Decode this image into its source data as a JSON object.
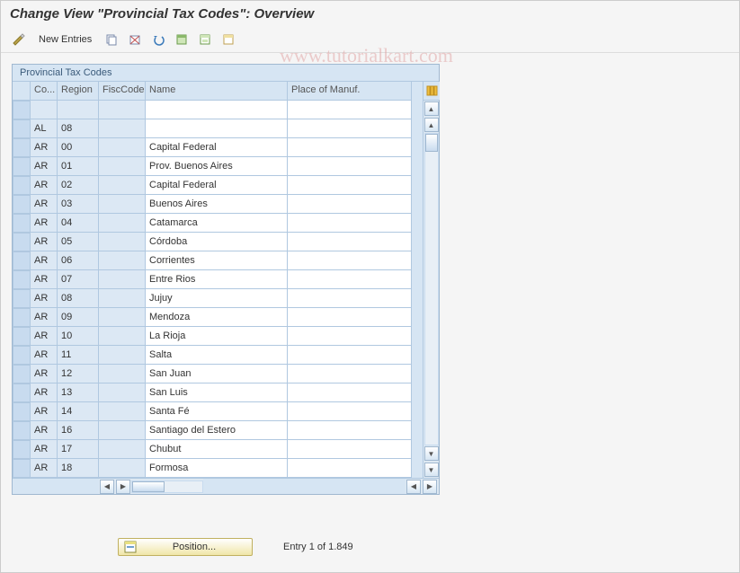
{
  "header": {
    "title": "Change View \"Provincial Tax Codes\": Overview"
  },
  "toolbar": {
    "new_entries": "New Entries"
  },
  "watermark": "www.tutorialkart.com",
  "grid": {
    "title": "Provincial Tax Codes",
    "columns": {
      "co": "Co...",
      "region": "Region",
      "fisc": "FiscCode",
      "name": "Name",
      "pom": "Place of Manuf."
    },
    "rows": [
      {
        "co": "",
        "region": "",
        "fisc": "",
        "name": "",
        "pom": ""
      },
      {
        "co": "AL",
        "region": "08",
        "fisc": "",
        "name": "",
        "pom": ""
      },
      {
        "co": "AR",
        "region": "00",
        "fisc": "",
        "name": "Capital Federal",
        "pom": ""
      },
      {
        "co": "AR",
        "region": "01",
        "fisc": "",
        "name": "Prov. Buenos Aires",
        "pom": ""
      },
      {
        "co": "AR",
        "region": "02",
        "fisc": "",
        "name": "Capital Federal",
        "pom": ""
      },
      {
        "co": "AR",
        "region": "03",
        "fisc": "",
        "name": "Buenos Aires",
        "pom": ""
      },
      {
        "co": "AR",
        "region": "04",
        "fisc": "",
        "name": "Catamarca",
        "pom": ""
      },
      {
        "co": "AR",
        "region": "05",
        "fisc": "",
        "name": "Córdoba",
        "pom": ""
      },
      {
        "co": "AR",
        "region": "06",
        "fisc": "",
        "name": "Corrientes",
        "pom": ""
      },
      {
        "co": "AR",
        "region": "07",
        "fisc": "",
        "name": "Entre Rios",
        "pom": ""
      },
      {
        "co": "AR",
        "region": "08",
        "fisc": "",
        "name": "Jujuy",
        "pom": ""
      },
      {
        "co": "AR",
        "region": "09",
        "fisc": "",
        "name": "Mendoza",
        "pom": ""
      },
      {
        "co": "AR",
        "region": "10",
        "fisc": "",
        "name": "La Rioja",
        "pom": ""
      },
      {
        "co": "AR",
        "region": "11",
        "fisc": "",
        "name": "Salta",
        "pom": ""
      },
      {
        "co": "AR",
        "region": "12",
        "fisc": "",
        "name": "San Juan",
        "pom": ""
      },
      {
        "co": "AR",
        "region": "13",
        "fisc": "",
        "name": "San Luis",
        "pom": ""
      },
      {
        "co": "AR",
        "region": "14",
        "fisc": "",
        "name": "Santa Fé",
        "pom": ""
      },
      {
        "co": "AR",
        "region": "16",
        "fisc": "",
        "name": "Santiago del Estero",
        "pom": ""
      },
      {
        "co": "AR",
        "region": "17",
        "fisc": "",
        "name": "Chubut",
        "pom": ""
      },
      {
        "co": "AR",
        "region": "18",
        "fisc": "",
        "name": "Formosa",
        "pom": ""
      }
    ]
  },
  "footer": {
    "position_label": "Position...",
    "entry_text": "Entry 1 of 1.849"
  }
}
